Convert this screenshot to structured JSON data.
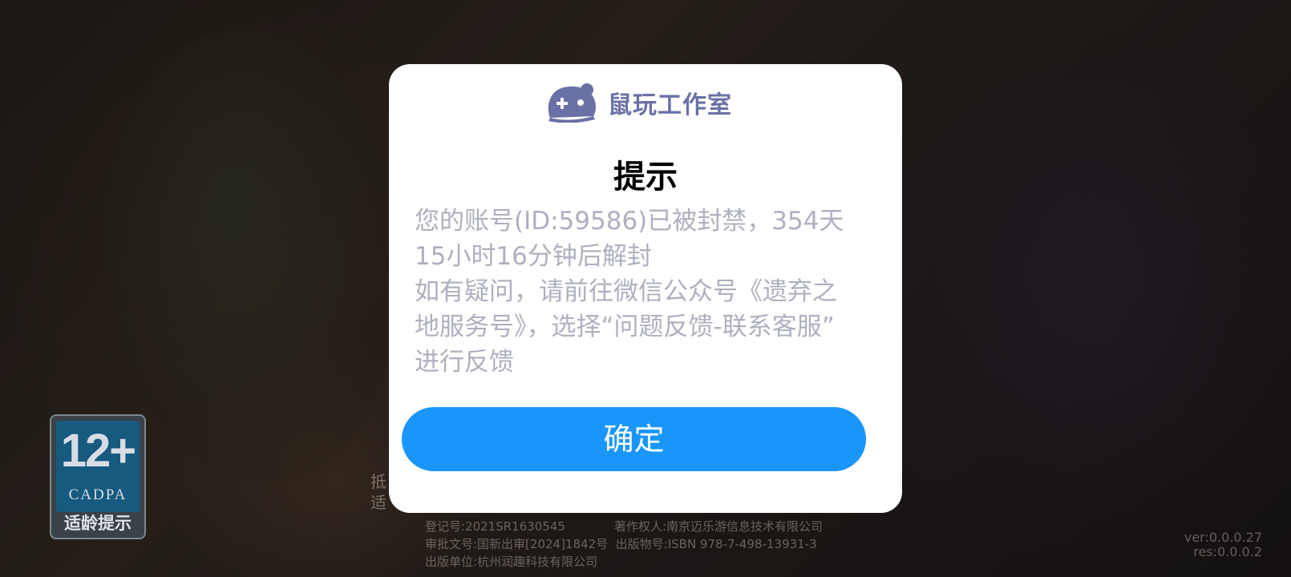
{
  "age_rating": {
    "number": "12+",
    "org": "CADPA",
    "label": "适龄提示"
  },
  "background_text": {
    "line1": "抵",
    "line2": "适"
  },
  "footer": {
    "registration": "登记号:2021SR1630545",
    "copyright_owner": "著作权人:南京迈乐游信息技术有限公司",
    "approval": "审批文号:国新出审[2024]1842号",
    "isbn": "出版物号:ISBN 978-7-498-13931-3",
    "publisher": "出版单位:杭州润趣科技有限公司"
  },
  "version": {
    "ver": "ver:0.0.0.27",
    "res": "res:0.0.0.2"
  },
  "dialog": {
    "logo_icon": "gamepad-mouse-icon",
    "logo_text": "鼠玩工作室",
    "title": "提示",
    "message_lines": [
      "您的账号(ID:59586)已被封禁，354天",
      "15小时16分钟后解封",
      "如有疑问，请前往微信公众号《遗弃之",
      "地服务号》，选择“问题反馈-联系客服”",
      "进行反馈"
    ],
    "confirm_label": "确定"
  },
  "colors": {
    "button": "#1a96fb",
    "logo": "#6a71a6",
    "message": "#aeb0c0"
  }
}
